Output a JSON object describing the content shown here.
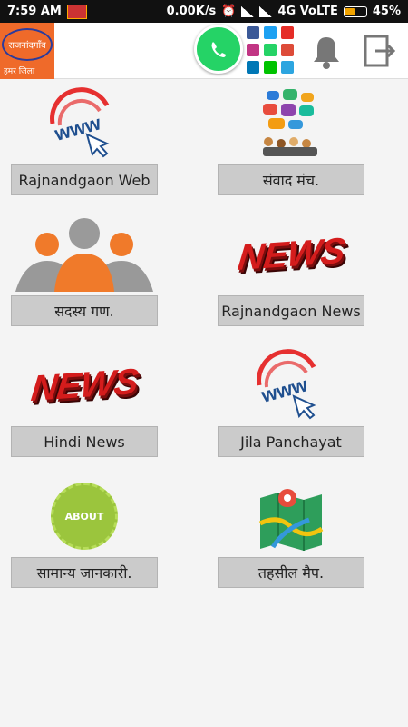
{
  "status": {
    "time": "7:59 AM",
    "net_speed": "0.00K/s",
    "network": "4G VoLTE",
    "battery": "45%",
    "battery_level": 0.45
  },
  "header": {
    "logo_title": "राजनांदगाँव",
    "logo_tagline": "हमर जिला"
  },
  "tiles": [
    {
      "label": "Rajnandgaon Web",
      "icon": "www-cursor-icon"
    },
    {
      "label": "संवाद मंच.",
      "icon": "chat-people-icon"
    },
    {
      "label": "सदस्य गण.",
      "icon": "members-icon"
    },
    {
      "label": "Rajnandgaon News",
      "icon": "news-icon"
    },
    {
      "label": "Hindi News",
      "icon": "news-icon"
    },
    {
      "label": "Jila Panchayat",
      "icon": "www-cursor-icon"
    },
    {
      "label": "सामान्य जानकारी.",
      "icon": "about-icon"
    },
    {
      "label": "तहसील मैप.",
      "icon": "map-icon"
    }
  ],
  "graphics": {
    "news_word": "NEWS",
    "about_word": "ABOUT"
  }
}
